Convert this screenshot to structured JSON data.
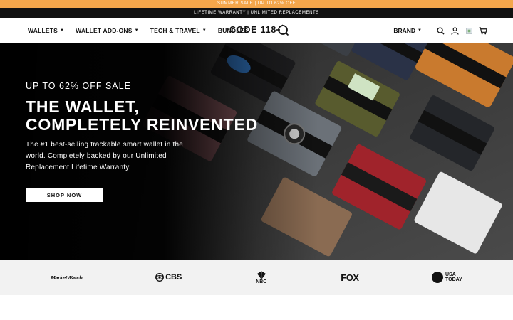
{
  "promo_bar": {
    "text": "SUMMER SALE | UP TO 62% OFF"
  },
  "warranty_bar": {
    "text": "LIFETIME WARRANTY | UNLIMITED REPLACEMENTS"
  },
  "nav": {
    "items": [
      {
        "label": "WALLETS"
      },
      {
        "label": "WALLET ADD-ONS"
      },
      {
        "label": "TECH & TRAVEL"
      },
      {
        "label": "BUNDLES"
      }
    ],
    "logo": "CODE 118",
    "brand_label": "BRAND",
    "icons": [
      "search-icon",
      "account-icon",
      "flag-icon",
      "cart-icon"
    ]
  },
  "hero": {
    "kicker": "UP TO 62% OFF SALE",
    "title_line1": "THE WALLET,",
    "title_line2": "COMPLETELY REINVENTED",
    "subtitle": "The #1 best-selling trackable smart wallet in the world. Completely backed by our Unlimited Replacement Lifetime Warranty.",
    "cta": "SHOP NOW"
  },
  "press": {
    "logos": [
      {
        "name": "MarketWatch"
      },
      {
        "name": "CBS"
      },
      {
        "name": "NBC"
      },
      {
        "name": "FOX"
      },
      {
        "name": "USA TODAY",
        "line1": "USA",
        "line2": "TODAY"
      }
    ]
  }
}
